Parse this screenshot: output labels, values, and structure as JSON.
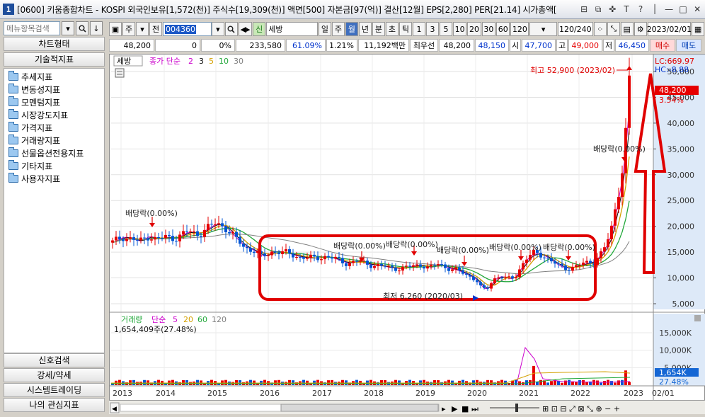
{
  "window": {
    "app_number": "1",
    "title": "[0600] 키움종합차트 - KOSPI 외국인보유[1,572(천)] 주식수[19,309(천)] 액면[500] 자본금[97(억)] 결산[12월] EPS[2,280] PER[21.14] 시가총액[",
    "controls": [
      "⊟",
      "⧉",
      "✜",
      "T",
      "?",
      "│",
      "—",
      "□",
      "✕"
    ]
  },
  "left_panel": {
    "search_placeholder": "메뉴항목검색",
    "buttons_top": [
      "차트형태",
      "기술적지표"
    ],
    "tree": [
      "추세지표",
      "변동성지표",
      "모멘텀지표",
      "시장강도지표",
      "가격지표",
      "거래량지표",
      "선물옵션전용지표",
      "기타지표",
      "사용자지표"
    ],
    "buttons_bottom": [
      "신호검색",
      "강세/약세",
      "시스템트레이딩",
      "나의 관심지표"
    ]
  },
  "toolbar": {
    "type1": "주",
    "type2": "전",
    "code": "004360",
    "name_badge": "신",
    "stock_name": "세방",
    "periods": [
      "일",
      "주",
      "월",
      "년",
      "분",
      "초",
      "틱"
    ],
    "selected_period": "월",
    "intervals": [
      "1",
      "3",
      "5",
      "10",
      "20",
      "30",
      "60",
      "120"
    ],
    "count": "120/240",
    "date": "2023/02/01"
  },
  "info": {
    "price": "48,200",
    "change": "0",
    "change_pct": "0%",
    "volume": "233,580",
    "rate1": "61.09%",
    "rate2": "1.21%",
    "amount": "11,192백만",
    "best_bid_label": "최우선",
    "best_bid": "48,200",
    "best_ask": "48,150",
    "open_label": "시",
    "open": "47,700",
    "high_label": "고",
    "high": "49,000",
    "low_label": "저",
    "low": "46,450",
    "buy": "매수",
    "sell": "매도"
  },
  "chart": {
    "legend_name": "세방",
    "legend_series": "종가 단순",
    "legend_periods": [
      "2",
      "3",
      "5",
      "10",
      "30"
    ],
    "high_annotation": "최고 52,900 (2023/02)",
    "low_annotation": "최저 6,260 (2020/03)",
    "dividend_label": "배당락(0.00%)",
    "lc_label": "LC:669.97",
    "hc_label": "HC:-8.88",
    "current_price_tag": "48,200",
    "current_pct_tag": "3.54%",
    "y_ticks": [
      "50,000",
      "45,000",
      "40,000",
      "35,000",
      "30,000",
      "25,000",
      "20,000",
      "15,000",
      "10,000",
      "5,000"
    ],
    "x_ticks": [
      "2013",
      "2014",
      "2015",
      "2016",
      "2017",
      "2018",
      "2019",
      "2020",
      "2021",
      "2022",
      "2023",
      "02/01"
    ]
  },
  "volume": {
    "legend_name": "거래량",
    "legend_series": "단순",
    "legend_periods": [
      "5",
      "20",
      "60",
      "120"
    ],
    "value_text": "1,654,409주(27.48%)",
    "y_ticks": [
      "15,000K",
      "10,000K",
      "5,000K"
    ],
    "current_tag": "1,654K",
    "current_pct_tag": "27.48%"
  },
  "colors": {
    "up": "#e60000",
    "down": "#0055d4",
    "ma2": "#cc00cc",
    "ma3": "#111111",
    "ma5": "#d4a000",
    "ma10": "#22a83a",
    "ma30": "#808080",
    "annotation": "#e00000",
    "axis_bg": "#dde9f8"
  }
}
